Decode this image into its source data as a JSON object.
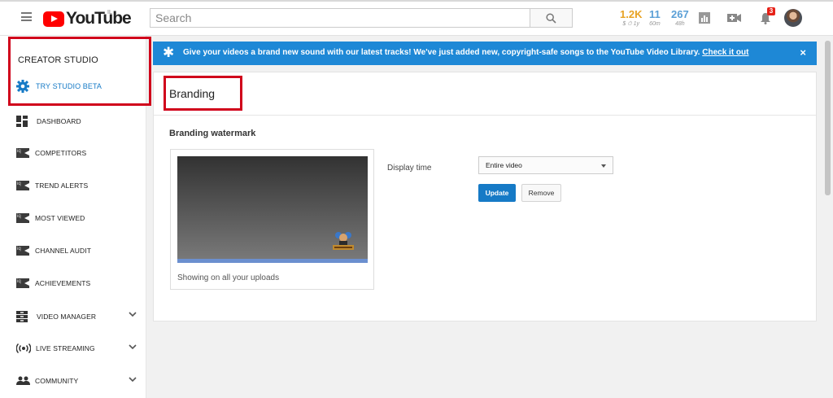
{
  "header": {
    "logo_text": "YouTube",
    "logo_country": "IL",
    "search_placeholder": "Search",
    "stats": [
      {
        "value": "1.2K",
        "sub": "$ ⏱ 1y",
        "color": "#e8a325"
      },
      {
        "value": "11",
        "sub": "60m",
        "color": "#5a9fd6"
      },
      {
        "value": "267",
        "sub": "48h",
        "color": "#5a9fd6"
      }
    ],
    "notification_count": "3"
  },
  "sidebar": {
    "heading": "CREATOR STUDIO",
    "studio_beta": "TRY STUDIO BETA",
    "items": [
      {
        "label": "DASHBOARD"
      },
      {
        "label": "COMPETITORS"
      },
      {
        "label": "TREND ALERTS"
      },
      {
        "label": "MOST VIEWED"
      },
      {
        "label": "CHANNEL AUDIT"
      },
      {
        "label": "ACHIEVEMENTS"
      },
      {
        "label": "VIDEO MANAGER"
      },
      {
        "label": "LIVE STREAMING"
      },
      {
        "label": "COMMUNITY"
      }
    ]
  },
  "banner": {
    "text": "Give your videos a brand new sound with our latest tracks! We've just added new, copyright-safe songs to the YouTube Video Library.",
    "link": "Check it out",
    "close": "×"
  },
  "main": {
    "title": "Branding",
    "section_title": "Branding watermark",
    "preview_caption": "Showing on all your uploads",
    "display_time_label": "Display time",
    "display_time_value": "Entire video",
    "update_label": "Update",
    "remove_label": "Remove"
  },
  "colors": {
    "accent": "#167ac6",
    "banner": "#1e88d6",
    "highlight_box": "#d0021b"
  }
}
